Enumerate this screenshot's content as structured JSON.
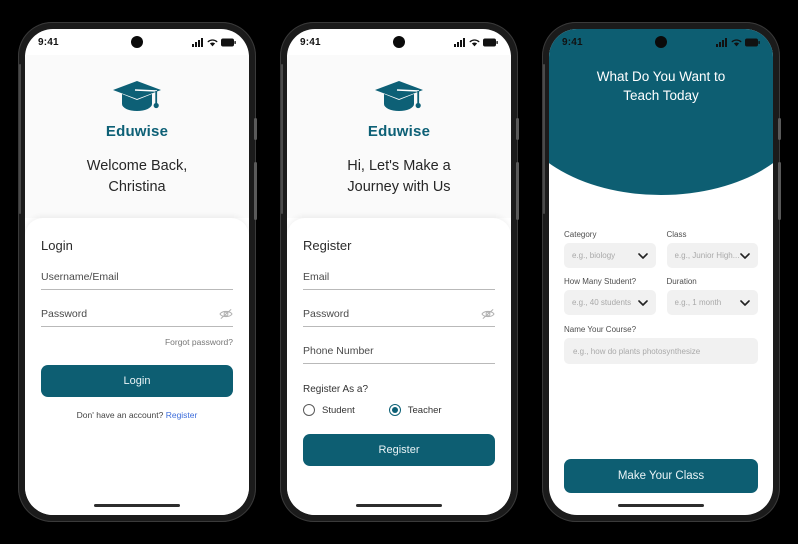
{
  "brand": {
    "name": "Eduwise",
    "logo_icon": "graduation-cap-icon",
    "accent_color": "#0d5e72",
    "link_color": "#3d6ddb"
  },
  "status_bar": {
    "time": "9:41",
    "icons": [
      "cellular-signal-icon",
      "wifi-icon",
      "battery-icon"
    ]
  },
  "screens": [
    {
      "id": "login",
      "headline": "Welcome Back,\nChristina",
      "headline_line1": "Welcome Back,",
      "headline_line2": "Christina",
      "card_title": "Login",
      "fields": [
        {
          "label": "Username/Email",
          "has_eye": false
        },
        {
          "label": "Password",
          "has_eye": true
        }
      ],
      "forgot_label": "Forgot password?",
      "submit_label": "Login",
      "footer_text": "Don' have an account?",
      "footer_link": "Register"
    },
    {
      "id": "register",
      "headline_line1": "Hi, Let's Make a",
      "headline_line2": "Journey with Us",
      "card_title": "Register",
      "fields": [
        {
          "label": "Email",
          "has_eye": false
        },
        {
          "label": "Password",
          "has_eye": true
        },
        {
          "label": "Phone Number",
          "has_eye": false
        }
      ],
      "role_label": "Register As a?",
      "roles": [
        {
          "label": "Student",
          "selected": false
        },
        {
          "label": "Teacher",
          "selected": true
        }
      ],
      "submit_label": "Register"
    },
    {
      "id": "teach",
      "hero_line1": "What Do You Want to",
      "hero_line2": "Teach Today",
      "selects": [
        {
          "label": "Category",
          "placeholder": "e.g., biology"
        },
        {
          "label": "Class",
          "placeholder": "e.g., Junior High..."
        },
        {
          "label": "How Many Student?",
          "placeholder": "e.g., 40 students"
        },
        {
          "label": "Duration",
          "placeholder": "e.g., 1 month"
        }
      ],
      "course_label": "Name Your Course?",
      "course_placeholder": "e.g., how do plants photosynthesize",
      "submit_label": "Make Your Class"
    }
  ]
}
